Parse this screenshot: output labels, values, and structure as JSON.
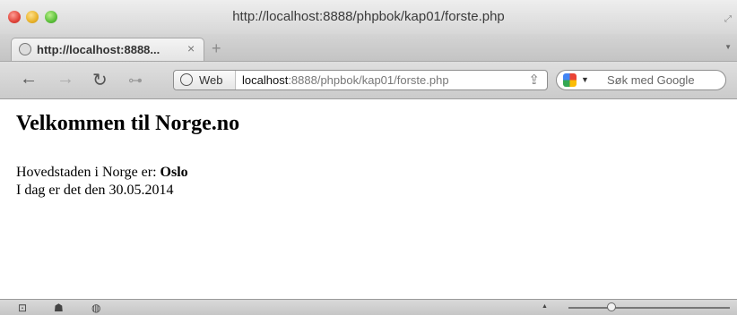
{
  "window": {
    "title": "http://localhost:8888/phpbok/kap01/forste.php"
  },
  "tab": {
    "label": "http://localhost:8888...",
    "close": "×",
    "new": "+"
  },
  "toolbar": {
    "back": "←",
    "forward": "→",
    "reload": "↻",
    "key": "⊶",
    "identity_label": "Web",
    "url_host": "localhost",
    "url_rest": ":8888/phpbok/kap01/forste.php",
    "share": "⇪",
    "search_placeholder": "Søk med Google",
    "search_dropdown": "▼"
  },
  "page": {
    "heading": "Velkommen til Norge.no",
    "capital_prefix": "Hovedstaden i Norge er: ",
    "capital": "Oslo",
    "date_line": "I dag er det den 30.05.2014"
  },
  "statusbar": {
    "icon1": "⊡",
    "icon2": "☗",
    "icon3": "◍",
    "arrow": "▲"
  },
  "colors": {
    "content_bg": "#ffffff",
    "chrome_bg": "#d7d7d7"
  }
}
